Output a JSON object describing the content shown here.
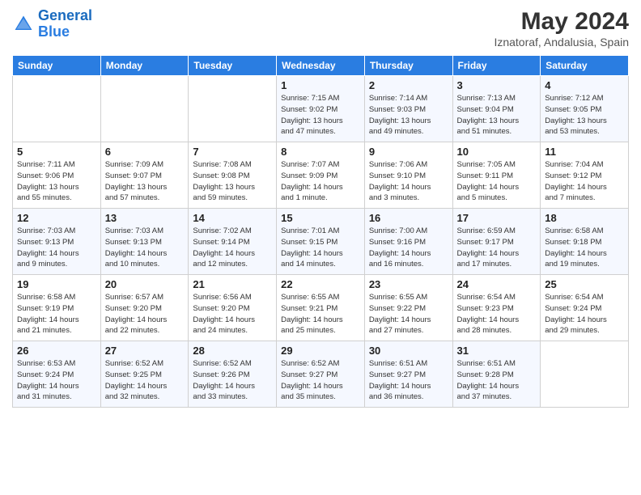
{
  "logo": {
    "line1": "General",
    "line2": "Blue"
  },
  "title": "May 2024",
  "subtitle": "Iznatoraf, Andalusia, Spain",
  "weekdays": [
    "Sunday",
    "Monday",
    "Tuesday",
    "Wednesday",
    "Thursday",
    "Friday",
    "Saturday"
  ],
  "weeks": [
    [
      {
        "day": "",
        "info": ""
      },
      {
        "day": "",
        "info": ""
      },
      {
        "day": "",
        "info": ""
      },
      {
        "day": "1",
        "info": "Sunrise: 7:15 AM\nSunset: 9:02 PM\nDaylight: 13 hours\nand 47 minutes."
      },
      {
        "day": "2",
        "info": "Sunrise: 7:14 AM\nSunset: 9:03 PM\nDaylight: 13 hours\nand 49 minutes."
      },
      {
        "day": "3",
        "info": "Sunrise: 7:13 AM\nSunset: 9:04 PM\nDaylight: 13 hours\nand 51 minutes."
      },
      {
        "day": "4",
        "info": "Sunrise: 7:12 AM\nSunset: 9:05 PM\nDaylight: 13 hours\nand 53 minutes."
      }
    ],
    [
      {
        "day": "5",
        "info": "Sunrise: 7:11 AM\nSunset: 9:06 PM\nDaylight: 13 hours\nand 55 minutes."
      },
      {
        "day": "6",
        "info": "Sunrise: 7:09 AM\nSunset: 9:07 PM\nDaylight: 13 hours\nand 57 minutes."
      },
      {
        "day": "7",
        "info": "Sunrise: 7:08 AM\nSunset: 9:08 PM\nDaylight: 13 hours\nand 59 minutes."
      },
      {
        "day": "8",
        "info": "Sunrise: 7:07 AM\nSunset: 9:09 PM\nDaylight: 14 hours\nand 1 minute."
      },
      {
        "day": "9",
        "info": "Sunrise: 7:06 AM\nSunset: 9:10 PM\nDaylight: 14 hours\nand 3 minutes."
      },
      {
        "day": "10",
        "info": "Sunrise: 7:05 AM\nSunset: 9:11 PM\nDaylight: 14 hours\nand 5 minutes."
      },
      {
        "day": "11",
        "info": "Sunrise: 7:04 AM\nSunset: 9:12 PM\nDaylight: 14 hours\nand 7 minutes."
      }
    ],
    [
      {
        "day": "12",
        "info": "Sunrise: 7:03 AM\nSunset: 9:13 PM\nDaylight: 14 hours\nand 9 minutes."
      },
      {
        "day": "13",
        "info": "Sunrise: 7:03 AM\nSunset: 9:13 PM\nDaylight: 14 hours\nand 10 minutes."
      },
      {
        "day": "14",
        "info": "Sunrise: 7:02 AM\nSunset: 9:14 PM\nDaylight: 14 hours\nand 12 minutes."
      },
      {
        "day": "15",
        "info": "Sunrise: 7:01 AM\nSunset: 9:15 PM\nDaylight: 14 hours\nand 14 minutes."
      },
      {
        "day": "16",
        "info": "Sunrise: 7:00 AM\nSunset: 9:16 PM\nDaylight: 14 hours\nand 16 minutes."
      },
      {
        "day": "17",
        "info": "Sunrise: 6:59 AM\nSunset: 9:17 PM\nDaylight: 14 hours\nand 17 minutes."
      },
      {
        "day": "18",
        "info": "Sunrise: 6:58 AM\nSunset: 9:18 PM\nDaylight: 14 hours\nand 19 minutes."
      }
    ],
    [
      {
        "day": "19",
        "info": "Sunrise: 6:58 AM\nSunset: 9:19 PM\nDaylight: 14 hours\nand 21 minutes."
      },
      {
        "day": "20",
        "info": "Sunrise: 6:57 AM\nSunset: 9:20 PM\nDaylight: 14 hours\nand 22 minutes."
      },
      {
        "day": "21",
        "info": "Sunrise: 6:56 AM\nSunset: 9:20 PM\nDaylight: 14 hours\nand 24 minutes."
      },
      {
        "day": "22",
        "info": "Sunrise: 6:55 AM\nSunset: 9:21 PM\nDaylight: 14 hours\nand 25 minutes."
      },
      {
        "day": "23",
        "info": "Sunrise: 6:55 AM\nSunset: 9:22 PM\nDaylight: 14 hours\nand 27 minutes."
      },
      {
        "day": "24",
        "info": "Sunrise: 6:54 AM\nSunset: 9:23 PM\nDaylight: 14 hours\nand 28 minutes."
      },
      {
        "day": "25",
        "info": "Sunrise: 6:54 AM\nSunset: 9:24 PM\nDaylight: 14 hours\nand 29 minutes."
      }
    ],
    [
      {
        "day": "26",
        "info": "Sunrise: 6:53 AM\nSunset: 9:24 PM\nDaylight: 14 hours\nand 31 minutes."
      },
      {
        "day": "27",
        "info": "Sunrise: 6:52 AM\nSunset: 9:25 PM\nDaylight: 14 hours\nand 32 minutes."
      },
      {
        "day": "28",
        "info": "Sunrise: 6:52 AM\nSunset: 9:26 PM\nDaylight: 14 hours\nand 33 minutes."
      },
      {
        "day": "29",
        "info": "Sunrise: 6:52 AM\nSunset: 9:27 PM\nDaylight: 14 hours\nand 35 minutes."
      },
      {
        "day": "30",
        "info": "Sunrise: 6:51 AM\nSunset: 9:27 PM\nDaylight: 14 hours\nand 36 minutes."
      },
      {
        "day": "31",
        "info": "Sunrise: 6:51 AM\nSunset: 9:28 PM\nDaylight: 14 hours\nand 37 minutes."
      },
      {
        "day": "",
        "info": ""
      }
    ]
  ]
}
